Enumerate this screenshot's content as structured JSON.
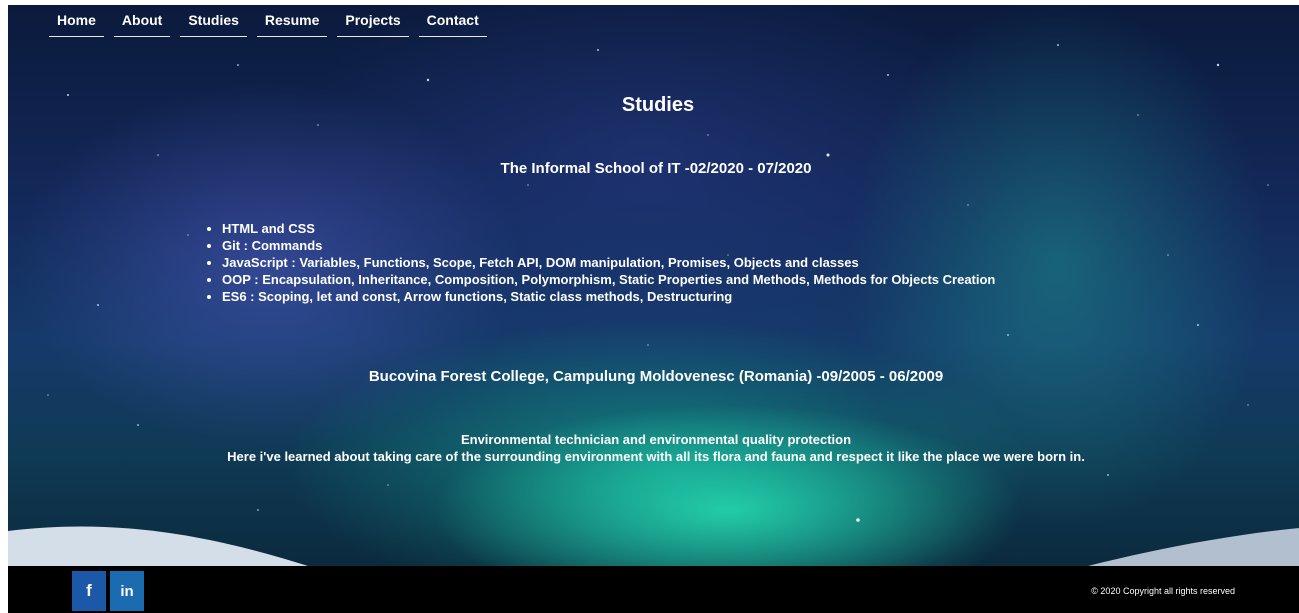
{
  "nav": {
    "items": [
      {
        "label": "Home"
      },
      {
        "label": "About"
      },
      {
        "label": "Studies"
      },
      {
        "label": "Resume"
      },
      {
        "label": "Projects"
      },
      {
        "label": "Contact"
      }
    ]
  },
  "studies": {
    "title": "Studies",
    "school": {
      "heading": "The Informal School of IT -02/2020 - 07/2020",
      "topics": [
        "HTML and CSS",
        "Git : Commands",
        "JavaScript : Variables, Functions, Scope, Fetch API, DOM manipulation, Promises, Objects and classes",
        "OOP : Encapsulation, Inheritance, Composition, Polymorphism, Static Properties and Methods, Methods for Objects Creation",
        "ES6 : Scoping, let and const, Arrow functions, Static class methods, Destructuring"
      ]
    },
    "college": {
      "heading": "Bucovina Forest College, Campulung Moldovenesc (Romania) -09/2005 - 06/2009",
      "degree": "Environmental technician and environmental quality protection",
      "description": "Here i've learned about taking care of the surrounding environment with all its flora and fauna and respect it like the place we were born in."
    }
  },
  "footer": {
    "social": [
      {
        "label": "f",
        "icon": "facebook-icon",
        "color": "#1c58a8"
      },
      {
        "label": "in",
        "icon": "linkedin-icon",
        "color": "#1a6bb0"
      }
    ],
    "copyright": "© 2020 Copyright all rights reserved"
  }
}
